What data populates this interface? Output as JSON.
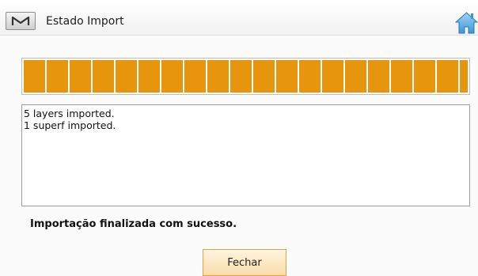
{
  "window": {
    "title": "Estado Import",
    "menu_icon": "m-logo-icon",
    "home_icon": "home-icon"
  },
  "progress": {
    "value_percent": 100,
    "color": "#e7950c"
  },
  "log": {
    "lines": [
      "5 layers imported.",
      "1 superf imported."
    ]
  },
  "status": {
    "message": "Importação finalizada com sucesso."
  },
  "actions": {
    "close_label": "Fechar"
  }
}
